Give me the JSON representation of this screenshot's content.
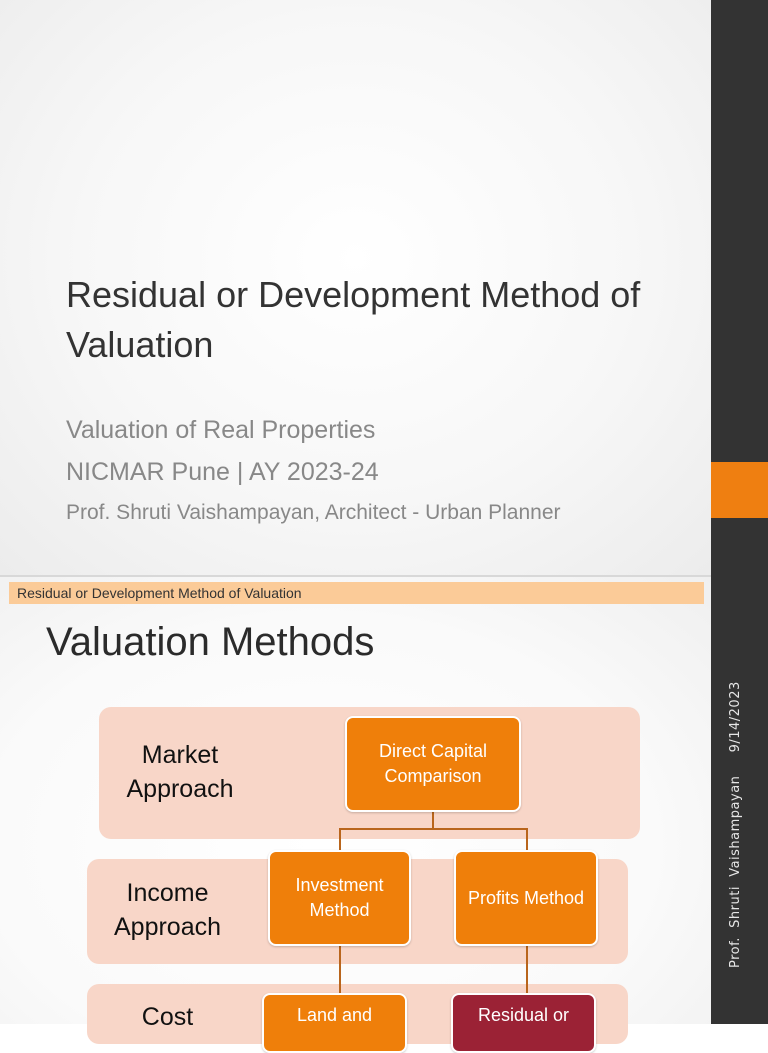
{
  "slide1": {
    "title": "Residual or Development Method of Valuation",
    "subtitle1": "Valuation of Real Properties",
    "subtitle2": "NICMAR Pune |  AY 2023-24",
    "subtitle3": "Prof. Shruti Vaishampayan, Architect - Urban Planner"
  },
  "sidebar": {
    "footer_text": "Prof.  Shruti  Vaishampayan     9/14/2023"
  },
  "slide2": {
    "header": "Residual or Development Method of Valuation",
    "title": "Valuation Methods",
    "approaches": [
      "Market Approach",
      "Income Approach",
      "Cost"
    ],
    "boxes": {
      "direct": "Direct Capital Comparison",
      "investment": "Investment Method",
      "profits": "Profits Method",
      "land": "Land and",
      "residual": "Residual or"
    }
  },
  "colors": {
    "accent": "#ef7f11",
    "sidebar": "#333333",
    "band": "#f8d6c8",
    "highlight": "#9b2235"
  }
}
